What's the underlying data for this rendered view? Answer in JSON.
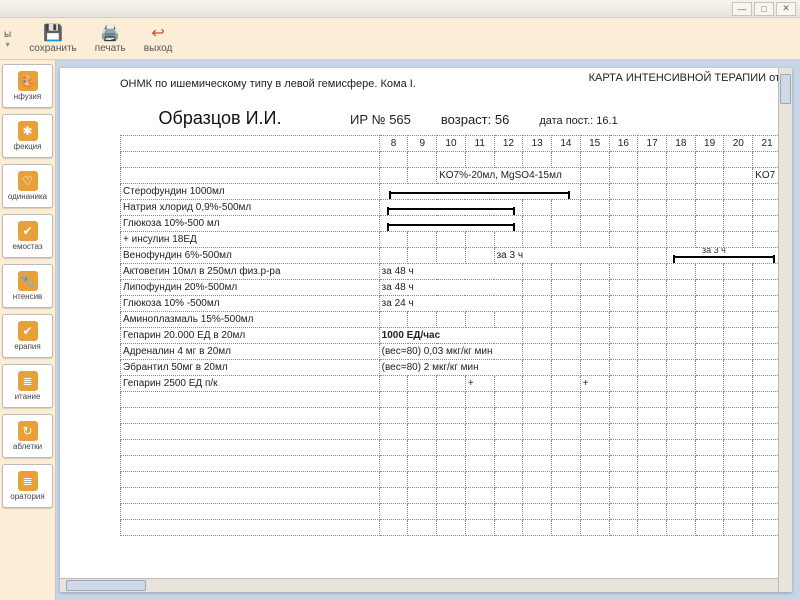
{
  "titlebar": {
    "min": "—",
    "max": "□",
    "close": "✕"
  },
  "toolbar": {
    "menu": "ы",
    "save": "сохранить",
    "print": "печать",
    "exit": "выход"
  },
  "sidebar": [
    {
      "id": "infusion",
      "label": "нфузия",
      "glyph": "🎨"
    },
    {
      "id": "infection",
      "label": "фекция",
      "glyph": "✱"
    },
    {
      "id": "dynamics",
      "label": "одинаника",
      "glyph": "♡"
    },
    {
      "id": "hemostasis",
      "label": "емостаз",
      "glyph": "✔"
    },
    {
      "id": "intensive",
      "label": "нтенсив",
      "glyph": "🔧"
    },
    {
      "id": "therapy",
      "label": "ерапия",
      "glyph": "✔"
    },
    {
      "id": "nutrition",
      "label": "итание",
      "glyph": "≣"
    },
    {
      "id": "tablets",
      "label": "аблетки",
      "glyph": "↻"
    },
    {
      "id": "lab",
      "label": "оратория",
      "glyph": "≣"
    }
  ],
  "doc": {
    "title": "КАРТА ИНТЕНСИВНОЙ ТЕРАПИИ от",
    "diagnosis": "ОНМК по ишемическому типу в левой гемисфере. Кома I.",
    "patient": "Образцов И.И.",
    "ir_label": "ИР №",
    "ir_value": "565",
    "age_label": "возраст:",
    "age_value": "56",
    "date_label": "дата пост.:",
    "date_value": "16.1"
  },
  "hours": [
    "8",
    "9",
    "10",
    "11",
    "12",
    "13",
    "14",
    "15",
    "16",
    "17",
    "18",
    "19",
    "20",
    "21"
  ],
  "annot": {
    "ko7": "KO7%-20мл, MgSO4-15мл",
    "ko7r": "KO7",
    "za3": "за 3 ч",
    "za48": "за 48 ч",
    "za24": "за 24 ч",
    "hep": "1000 ЕД/час",
    "adr": "(вес=80)  0,03 мкг/кг мин",
    "ebr": "(вес=80)  2 мкг/кг мин",
    "plus": "+"
  },
  "rows": [
    {
      "name": "Стерофундин 1000мл",
      "seg": [
        8,
        14
      ]
    },
    {
      "name": "Натрия хлорид 0,9%-500мл",
      "seg": [
        8,
        12
      ]
    },
    {
      "name": "Глюкоза 10%-500 мл",
      "seg": [
        8,
        12
      ]
    },
    {
      "name": "  + инсулин 18ЕД"
    },
    {
      "name": "Венофундин 6%-500мл",
      "note_at": 12,
      "note_key": "za3",
      "seg2": [
        18,
        21
      ],
      "note2_at": 19,
      "note2_key": "za3"
    },
    {
      "name": "Актовегин 10мл в 250мл физ.р-ра",
      "note_at": 8,
      "note_key": "za48"
    },
    {
      "name": "Липофундин 20%-500мл",
      "note_at": 8,
      "note_key": "za48"
    },
    {
      "name": "Глюкоза 10% -500мл",
      "note_at": 8,
      "note_key": "za24"
    },
    {
      "name": "Аминоплазмаль 15%-500мл"
    },
    {
      "name": "Гепарин 20.000 ЕД в 20мл",
      "note_at": 8,
      "note_key": "hep",
      "bold": true
    },
    {
      "name": "Адреналин 4 мг в 20мл",
      "note_at": 8,
      "note_key": "adr"
    },
    {
      "name": "Эбрантил 50мг в 20мл",
      "note_at": 8,
      "note_key": "ebr"
    },
    {
      "name": "Гепарин 2500 ЕД  п/к",
      "plus_at": [
        11,
        15
      ]
    }
  ],
  "empty_rows": 9
}
